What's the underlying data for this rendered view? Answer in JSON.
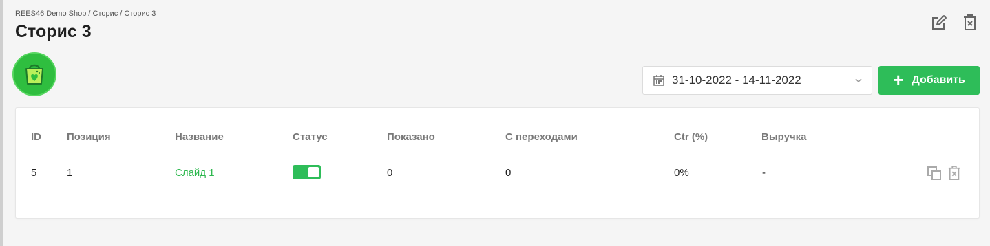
{
  "breadcrumb": "REES46 Demo Shop / Сторис / Сторис 3",
  "page_title": "Сторис 3",
  "date_range": "31-10-2022 - 14-11-2022",
  "add_button_label": "Добавить",
  "table": {
    "headers": {
      "id": "ID",
      "position": "Позиция",
      "name": "Название",
      "status": "Статус",
      "shown": "Показано",
      "clicks": "С переходами",
      "ctr": "Ctr (%)",
      "revenue": "Выручка"
    },
    "rows": [
      {
        "id": "5",
        "position": "1",
        "name": "Слайд 1",
        "status_on": true,
        "shown": "0",
        "clicks": "0",
        "ctr": "0%",
        "revenue": "-"
      }
    ]
  },
  "colors": {
    "accent": "#2ebd59",
    "link": "#2eb84f",
    "avatar": "#2fbe3f",
    "background": "#f5f5f5"
  },
  "icons": {
    "edit": "edit-icon",
    "delete": "delete-icon",
    "calendar": "calendar-icon",
    "chevron": "chevron-down-icon",
    "copy": "copy-icon",
    "avatar": "shopping-bag-icon"
  }
}
